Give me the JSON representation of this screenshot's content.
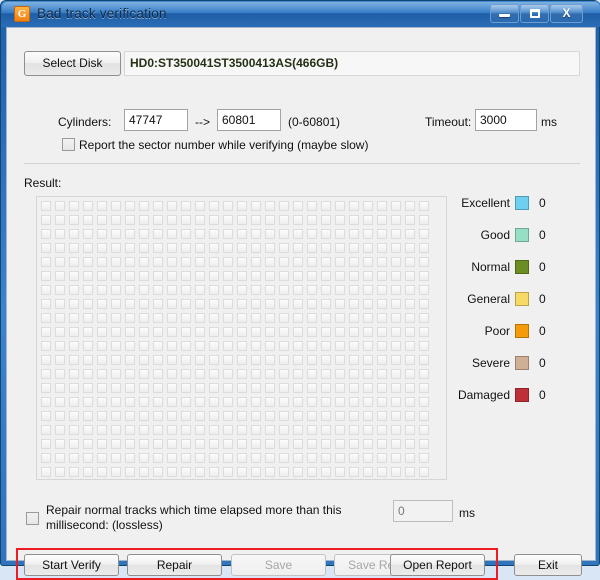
{
  "window": {
    "title": "Bad track verification",
    "icon": "app-icon",
    "caption_buttons": {
      "minimize": "minimize-icon",
      "maximize": "maximize-icon",
      "close": "X"
    }
  },
  "disk": {
    "select_button": "Select Disk",
    "current": "HD0:ST350041ST3500413AS(466GB)"
  },
  "cylinders": {
    "label": "Cylinders:",
    "from": "47747",
    "arrow": "-->",
    "to": "60801",
    "range": "(0-60801)"
  },
  "timeout": {
    "label": "Timeout:",
    "value": "3000",
    "unit": "ms"
  },
  "report_sector": {
    "label": "Report the sector number while verifying (maybe slow)",
    "checked": false
  },
  "result": {
    "label": "Result:",
    "grid": {
      "columns": 28,
      "rows": 20,
      "filled": 0
    }
  },
  "legend": {
    "items": [
      {
        "name": "Excellent",
        "color": "#6ecff0",
        "count": "0"
      },
      {
        "name": "Good",
        "color": "#97dfc4",
        "count": "0"
      },
      {
        "name": "Normal",
        "color": "#6b8d22",
        "count": "0"
      },
      {
        "name": "General",
        "color": "#f7d966",
        "count": "0"
      },
      {
        "name": "Poor",
        "color": "#f59b0b",
        "count": "0"
      },
      {
        "name": "Severe",
        "color": "#cfb095",
        "count": "0"
      },
      {
        "name": "Damaged",
        "color": "#bd3038",
        "count": "0"
      }
    ]
  },
  "repair_option": {
    "label": "Repair normal tracks which time elapsed more than this millisecond: (lossless)",
    "checked": false,
    "value": "0",
    "unit": "ms"
  },
  "buttons": {
    "start_verify": "Start Verify",
    "repair": "Repair",
    "save": "Save",
    "save_report": "Save Report",
    "open_report": "Open Report",
    "exit": "Exit"
  },
  "highlight": {
    "color": "#ee1b24"
  }
}
